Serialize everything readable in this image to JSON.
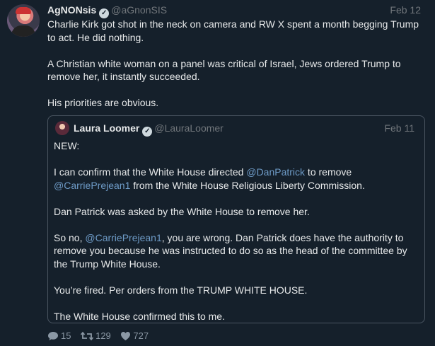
{
  "tweet": {
    "author_name": "AgNONsis",
    "author_handle": "@aGnonSIS",
    "date": "Feb 12",
    "paragraphs": [
      "Charlie Kirk got shot in the neck on camera and RW X spent a month begging Trump to act. He did nothing.",
      "A Christian white woman on a panel was critical of Israel, Jews ordered Trump to remove her, it instantly succeeded.",
      "His priorities are obvious."
    ]
  },
  "quote": {
    "author_name": "Laura Loomer",
    "author_handle": "@LauraLoomer",
    "date": "Feb 11",
    "p1": "NEW:",
    "p2": {
      "a": "I can confirm that the White House directed ",
      "mention1": "@DanPatrick",
      "b": " to remove ",
      "mention2": "@CarriePrejean1",
      "c": " from the White House Religious Liberty Commission."
    },
    "p3": "Dan Patrick was asked by the White House to remove her.",
    "p4": {
      "a": "So no, ",
      "mention": "@CarriePrejean1",
      "b": ", you are wrong. Dan Patrick does have the authority to remove you because he was instructed to do so as the head of the committee by the Trump White House."
    },
    "p5": "You’re fired. Per orders from the TRUMP WHITE HOUSE.",
    "p6": "The White House confirmed this to me."
  },
  "actions": {
    "replies": "15",
    "retweets": "129",
    "likes": "727"
  },
  "icons": {
    "verified": "verified-badge-icon",
    "reply": "reply-icon",
    "retweet": "retweet-icon",
    "like": "heart-icon"
  }
}
